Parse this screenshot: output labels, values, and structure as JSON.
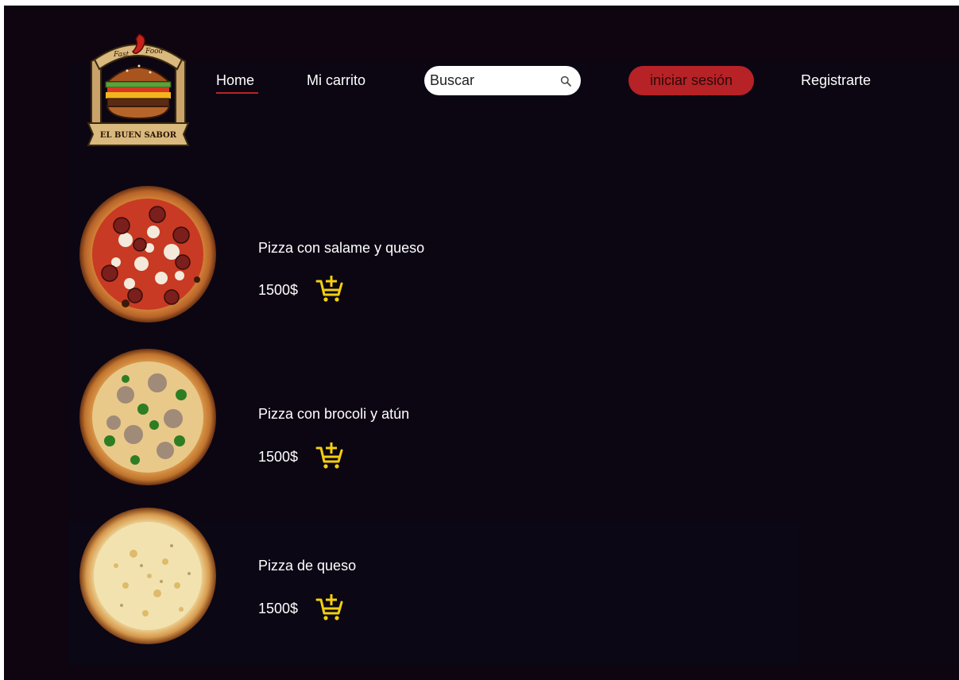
{
  "logo": {
    "top_text_left": "Fast",
    "top_text_right": "Food",
    "banner_text": "EL BUEN SABOR"
  },
  "nav": {
    "home": "Home",
    "cart": "Mi carrito",
    "register": "Registrarte"
  },
  "search": {
    "placeholder": "Buscar"
  },
  "login": {
    "label": "iniciar sesión"
  },
  "products": [
    {
      "name": "Pizza con salame y queso",
      "price": "1500$",
      "icon": "add-to-cart-icon"
    },
    {
      "name": "Pizza con brocoli y atún",
      "price": "1500$",
      "icon": "add-to-cart-icon"
    },
    {
      "name": "Pizza de queso",
      "price": "1500$",
      "icon": "add-to-cart-icon"
    }
  ],
  "colors": {
    "background": "#0e0511",
    "accent_red": "#b72226",
    "cart_yellow": "#f3cf10",
    "text": "#ffffff"
  }
}
